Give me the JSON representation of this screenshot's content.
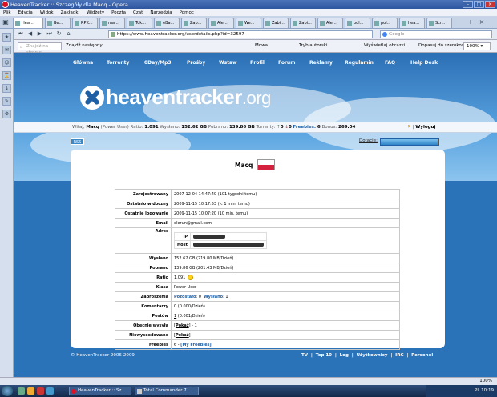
{
  "window": {
    "title": "HeavenTracker :: Szczegóły dla Macq - Opera"
  },
  "menu": [
    "Plik",
    "Edycja",
    "Widok",
    "Zakładki",
    "Widżety",
    "Poczta",
    "Czat",
    "Narzędzia",
    "Pomoc"
  ],
  "tabs": [
    "Hea...",
    "Be...",
    "RPK...",
    "ma...",
    "Tok...",
    "eBa...",
    "Zap...",
    "Ale...",
    "We...",
    "Zabi...",
    "Zabi...",
    "Ale...",
    "pol...",
    "pol...",
    "hea...",
    "Scr..."
  ],
  "address": {
    "url": "https://www.heaventracker.org/userdetails.php?id=32597",
    "search_placeholder": "Google"
  },
  "toolbar": {
    "find_placeholder": "Znajdź na stronie",
    "find_next": "Znajdź następny",
    "speech": "Mowa",
    "author_mode": "Tryb autorski",
    "show_images": "Wyświetlaj obrazki",
    "fit_width": "Dopasuj do szerokości",
    "zoom": "100%"
  },
  "nav": [
    "Główna",
    "Torrenty",
    "0Day/Mp3",
    "Prośby",
    "Wstaw",
    "Profil",
    "Forum",
    "Reklamy",
    "Regulamin",
    "FAQ",
    "Help Desk"
  ],
  "logo": {
    "main": "heaventracker",
    "tld": ".org"
  },
  "userbar": {
    "welcome": "Witaj,",
    "user": "Macq",
    "class": "(Power User)",
    "ratio_label": "Ratio:",
    "ratio": "1.091",
    "upl_label": "Wysłano:",
    "upl": "152.62 GB",
    "dl_label": "Pobrano:",
    "dl": "139.86 GB",
    "torrents_label": "Torrenty:",
    "seeding": "0",
    "leeching": "0",
    "freebies_label": "Freebies:",
    "freebies": "6",
    "bonus_label": "Bonus:",
    "bonus": "269.04",
    "logout": "Wyloguj"
  },
  "rss": "RSS",
  "donation": {
    "label": "Dotacje:",
    "progress": 0.98
  },
  "profile": {
    "username": "Macq",
    "rows": {
      "registered": {
        "k": "Zarejestrowany",
        "v": "2007-12-04 14:47:40 (101 tygodni temu)"
      },
      "last_seen": {
        "k": "Ostatnio widoczny",
        "v": "2009-11-15 10:17:53 (< 1 min. temu)"
      },
      "last_login": {
        "k": "Ostatnie logowanie",
        "v": "2009-11-15 10:07:20 (10 min. temu)"
      },
      "email": {
        "k": "Email",
        "v": "elerun@gmail.com"
      },
      "address": {
        "k": "Adres",
        "ip": "IP",
        "host": "Host"
      },
      "uploaded": {
        "k": "Wysłano",
        "v": "152.62 GB (219.80 MB/Dzień)"
      },
      "downloaded": {
        "k": "Pobrano",
        "v": "139.86 GB (201.43 MB/Dzień)"
      },
      "ratio": {
        "k": "Ratio",
        "v": "1.091"
      },
      "class": {
        "k": "Klasa",
        "v": "Power User"
      },
      "invites": {
        "k": "Zaproszenia",
        "left": "Pozostało",
        "left_v": ": 0",
        "sent": "Wysłano",
        "sent_v": ": 1"
      },
      "comments": {
        "k": "Komentarzy",
        "v": "0 (0.000/Dzień)"
      },
      "posts": {
        "k": "Postów",
        "count": "1",
        "rate": " (0.001/Dzień)"
      },
      "seeding": {
        "k": "Obecnie wysyła",
        "link": "Pokaż",
        "rest": " - 1"
      },
      "unseeded": {
        "k": "Niewyseedowane",
        "link": "Pokaż"
      },
      "freebies": {
        "k": "Freebies",
        "count": "6 - ",
        "link": "[My Freebies]"
      }
    }
  },
  "footer": {
    "copy": "© HeavenTracker 2006-2009",
    "links": [
      "TV",
      "Top 10",
      "Log",
      "Użytkownicy",
      "IRC",
      "Personel"
    ]
  },
  "statusbar": {
    "zoom": "100%"
  },
  "taskbar": {
    "buttons": [
      "HeavenTracker :: Sz...",
      "Total Commander 7...."
    ],
    "tray": "PL  10:19"
  }
}
